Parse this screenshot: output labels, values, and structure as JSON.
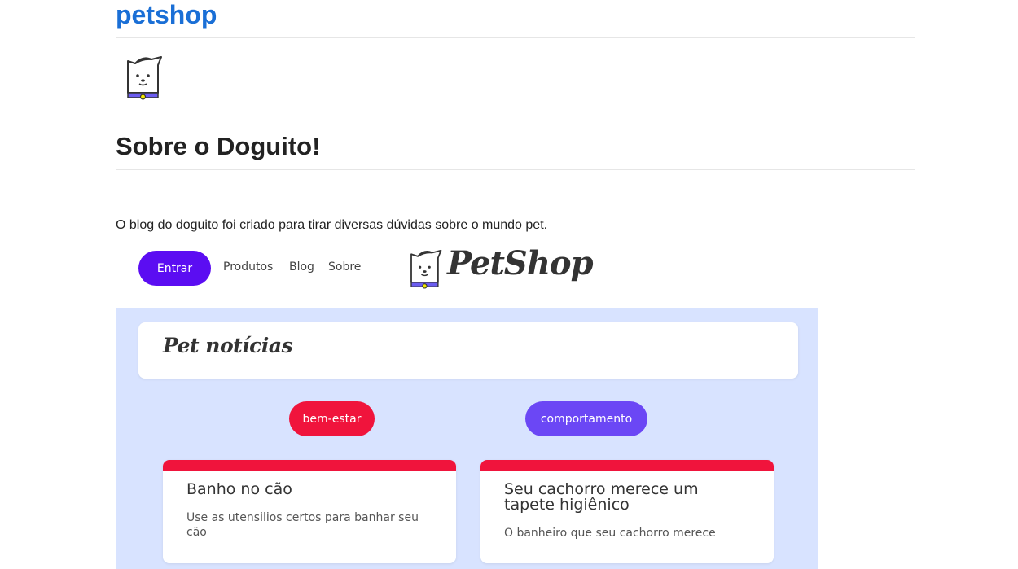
{
  "site": {
    "title": "petshop"
  },
  "about": {
    "title": "Sobre o Doguito!",
    "text": "O blog do doguito foi criado para tirar diversas dúvidas sobre o mundo pet."
  },
  "header": {
    "login_label": "Entrar",
    "nav": [
      "Produtos",
      "Blog",
      "Sobre"
    ],
    "brand": "PetShop",
    "logo_icon": "doguito-logo-icon"
  },
  "news": {
    "title": "Pet notícias",
    "tags": [
      {
        "label": "bem-estar",
        "color": "#f0143c"
      },
      {
        "label": "comportamento",
        "color": "#6b47f5"
      }
    ],
    "cards": [
      {
        "title": "Banho no cão",
        "text": "Use as utensilios certos para banhar seu cão"
      },
      {
        "title": "Seu cachorro merece um tapete higiênico",
        "text": "O banheiro que seu cachorro merece"
      }
    ]
  },
  "colors": {
    "link_blue": "#1a6fd6",
    "primary_purple": "#5b0df2",
    "panel_bg": "#d8e3ff",
    "card_accent": "#f0143c"
  }
}
